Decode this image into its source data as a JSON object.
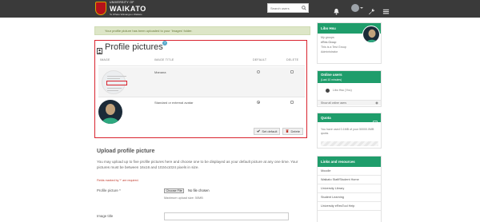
{
  "header": {
    "logo_small": "UNIVERSITY OF",
    "logo_big": "WAIKATO",
    "logo_tag": "Te Whare Wānanga o Waikato",
    "search_placeholder": "Search users"
  },
  "alert": {
    "text": "Your profile picture has been uploaded to your 'Images' folder."
  },
  "profile_pictures": {
    "title": "Profile pictures",
    "columns": [
      "IMAGE",
      "IMAGE TITLE",
      "DEFAULT",
      "DELETE"
    ],
    "rows": [
      {
        "title": "Manana",
        "default": false,
        "delete": false
      },
      {
        "title": "Standard or external avatar",
        "default": true,
        "delete": false
      }
    ],
    "set_default_label": "Set default",
    "delete_label": "Delete"
  },
  "upload": {
    "title": "Upload profile picture",
    "description": "You may upload up to five profile pictures here and choose one to be displayed as your default picture at any one time. Your pictures must be between 16x16 and 1024x1024 pixels in size.",
    "required_note": "Fields marked by '*' are required.",
    "picture_label": "Profile picture *",
    "choose_file_label": "Choose File",
    "no_file_text": "No file chosen",
    "max_size": "Maximum upload size: 50MB",
    "image_title_label": "Image title"
  },
  "sidebar": {
    "user": {
      "name": "Libo Hsu",
      "my_groups_label": "My groups",
      "group_name": "eRes Group",
      "group_desc": "This is a Test Group",
      "role": "Administrator"
    },
    "online": {
      "title": "Online users",
      "subtitle": "(Last 10 minutes)",
      "user_name": "Libo Hsu (You)",
      "show_all": "Show all online users"
    },
    "quota": {
      "title": "Quota",
      "text": "You have used 0.1MB of your 50000.0MB quota.",
      "fraction": 2e-06
    },
    "links": {
      "title": "Links and resources",
      "items": [
        "Moodle",
        "Waikato Staff/Student Home",
        "University Library",
        "Student Learning",
        "University eResTool Help"
      ]
    }
  },
  "colors": {
    "topbar": "#3a3a3a",
    "accent_green": "#1f9d6b",
    "highlight_red": "#d9232e",
    "alert_bg": "#dde6c7"
  }
}
